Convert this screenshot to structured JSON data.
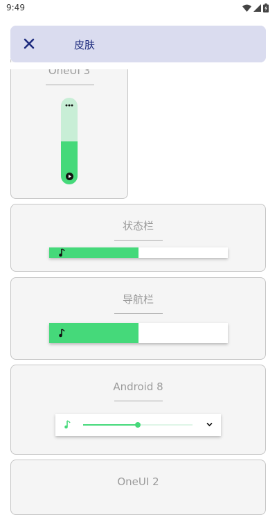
{
  "status_bar": {
    "time": "9:49"
  },
  "appbar": {
    "title": "皮肤",
    "close_icon": "close-icon"
  },
  "colors": {
    "accent": "#45d97a",
    "accent_light": "#c8eed6",
    "appbar_bg": "#dadcef",
    "appbar_fg": "#1d2b7e"
  },
  "skins": [
    {
      "title": "OneUI 3",
      "progress": 0.4
    },
    {
      "title": "状态栏",
      "progress": 0.5
    },
    {
      "title": "导航栏",
      "progress": 0.5
    },
    {
      "title": "Android 8",
      "progress": 0.5
    },
    {
      "title": "OneUI 2"
    }
  ]
}
